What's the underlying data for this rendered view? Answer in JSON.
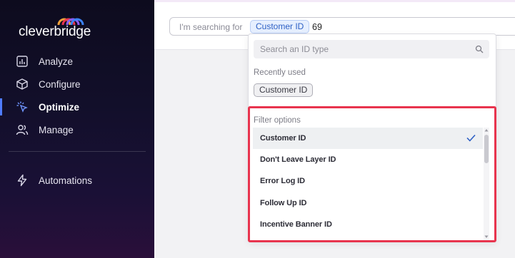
{
  "brand": {
    "name": "cleverbridge"
  },
  "sidebar": {
    "items": [
      {
        "label": "Analyze",
        "icon": "chart-icon"
      },
      {
        "label": "Configure",
        "icon": "cube-icon"
      },
      {
        "label": "Optimize",
        "icon": "pointer-click-icon",
        "active": true
      },
      {
        "label": "Manage",
        "icon": "users-icon"
      },
      {
        "label": "Automations",
        "icon": "lightning-icon"
      }
    ]
  },
  "search": {
    "prefix": "I'm searching for",
    "selected_type": "Customer ID",
    "value": "69"
  },
  "dropdown": {
    "search_placeholder": "Search an ID type",
    "recent_heading": "Recently used",
    "recent_items": [
      "Customer ID"
    ],
    "filter_heading": "Filter options",
    "options": [
      {
        "label": "Customer ID",
        "selected": true
      },
      {
        "label": "Don't Leave Layer ID"
      },
      {
        "label": "Error Log ID"
      },
      {
        "label": "Follow Up ID"
      },
      {
        "label": "Incentive Banner ID"
      }
    ]
  },
  "colors": {
    "accent_red": "#e8344e",
    "chip_blue": "#2d5fc4",
    "sidebar_bg": "#0d0b1e",
    "active_indicator": "#4f7cff"
  }
}
